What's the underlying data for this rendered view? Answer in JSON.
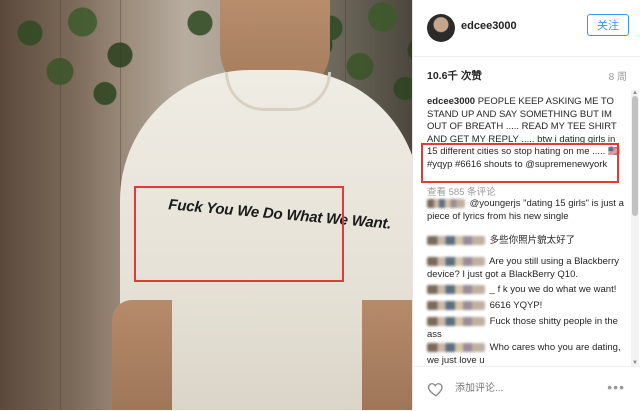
{
  "photo": {
    "shirt_text": "Fuck You We Do What We Want."
  },
  "post": {
    "username": "edcee3000",
    "follow_label": "关注",
    "likes": "10.6千 次赞",
    "age": "8 周",
    "caption_author": "edcee3000",
    "caption_text": "PEOPLE KEEP ASKING ME TO STAND UP AND SAY SOMETHING BUT IM OUT OF BREATH ..... READ MY TEE SHIRT AND GET MY REPLY ..... btw i dating girls in 15 different cities so stop hating on me ..... 🇺🇸#yqyp #6616 shouts to @supremenewyork",
    "view_comments": "查看 585 条评论",
    "comments": [
      {
        "text": "@youngerjs \"dating 15 girls\" is just a piece of lyrics from his new single"
      },
      {
        "text": "多些你照片貌太好了"
      },
      {
        "text": "Are you still using a Blackberry device? I just got a BlackBerry Q10."
      },
      {
        "text": "_ f k you we do what we want!"
      },
      {
        "text": "6616 YQYP!"
      },
      {
        "text": "Fuck those shitty people in the ass"
      },
      {
        "text": "Who cares who you are dating, we just love u"
      }
    ],
    "add_comment_placeholder": "添加评论...",
    "more_label": "•••"
  },
  "colors": {
    "highlight": "#e03a3a",
    "follow_blue": "#3897f0"
  },
  "icons": [
    "heart-icon",
    "more-icon",
    "avatar"
  ]
}
